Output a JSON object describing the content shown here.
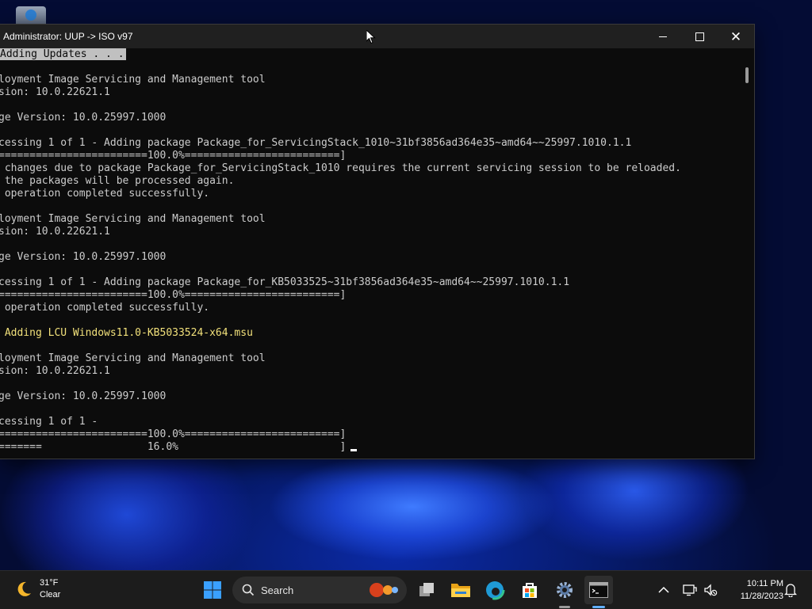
{
  "window": {
    "title": "Administrator:  UUP -> ISO v97"
  },
  "console_lines": [
    {
      "text": "Adding Updates . . .",
      "style": "highlight"
    },
    {
      "text": "",
      "style": "normal"
    },
    {
      "text": "loyment Image Servicing and Management tool",
      "style": "normal"
    },
    {
      "text": "sion: 10.0.22621.1",
      "style": "normal"
    },
    {
      "text": "",
      "style": "normal"
    },
    {
      "text": "ge Version: 10.0.25997.1000",
      "style": "normal"
    },
    {
      "text": "",
      "style": "normal"
    },
    {
      "text": "cessing 1 of 1 - Adding package Package_for_ServicingStack_1010~31bf3856ad364e35~amd64~~25997.1010.1.1",
      "style": "normal"
    },
    {
      "text": "========================100.0%=========================]",
      "style": "normal"
    },
    {
      "text": " changes due to package Package_for_ServicingStack_1010 requires the current servicing session to be reloaded.",
      "style": "normal"
    },
    {
      "text": " the packages will be processed again.",
      "style": "normal"
    },
    {
      "text": " operation completed successfully.",
      "style": "normal"
    },
    {
      "text": "",
      "style": "normal"
    },
    {
      "text": "loyment Image Servicing and Management tool",
      "style": "normal"
    },
    {
      "text": "sion: 10.0.22621.1",
      "style": "normal"
    },
    {
      "text": "",
      "style": "normal"
    },
    {
      "text": "ge Version: 10.0.25997.1000",
      "style": "normal"
    },
    {
      "text": "",
      "style": "normal"
    },
    {
      "text": "cessing 1 of 1 - Adding package Package_for_KB5033525~31bf3856ad364e35~amd64~~25997.1010.1.1",
      "style": "normal"
    },
    {
      "text": "========================100.0%=========================]",
      "style": "normal"
    },
    {
      "text": " operation completed successfully.",
      "style": "normal"
    },
    {
      "text": "",
      "style": "normal"
    },
    {
      "text": " Adding LCU Windows11.0-KB5033524-x64.msu",
      "style": "yellow"
    },
    {
      "text": "",
      "style": "normal"
    },
    {
      "text": "loyment Image Servicing and Management tool",
      "style": "normal"
    },
    {
      "text": "sion: 10.0.22621.1",
      "style": "normal"
    },
    {
      "text": "",
      "style": "normal"
    },
    {
      "text": "ge Version: 10.0.25997.1000",
      "style": "normal"
    },
    {
      "text": "",
      "style": "normal"
    },
    {
      "text": "cessing 1 of 1 -",
      "style": "normal"
    },
    {
      "text": "========================100.0%=========================]",
      "style": "normal"
    },
    {
      "text": "=======                 16.0%                          ]",
      "style": "cursor"
    }
  ],
  "taskbar": {
    "weather_temp": "31°F",
    "weather_desc": "Clear",
    "search_label": "Search",
    "clock_time": "10:11 PM",
    "clock_date": "11/28/2023",
    "apps": [
      {
        "name": "start-button",
        "icon": "windows-logo-icon"
      },
      {
        "name": "task-view-button",
        "icon": "task-view-icon"
      },
      {
        "name": "file-explorer-button",
        "icon": "folder-icon"
      },
      {
        "name": "edge-button",
        "icon": "edge-icon"
      },
      {
        "name": "store-button",
        "icon": "store-icon"
      },
      {
        "name": "settings-button",
        "icon": "gear-icon"
      },
      {
        "name": "terminal-button",
        "icon": "terminal-icon"
      }
    ]
  },
  "colors": {
    "console_bg": "#0c0c0c",
    "console_text": "#cccccc",
    "highlight_bg": "#c0c0c0",
    "yellow_text": "#f1e07a",
    "taskbar_bg": "#1c1c1c",
    "accent": "#62b0ff"
  }
}
